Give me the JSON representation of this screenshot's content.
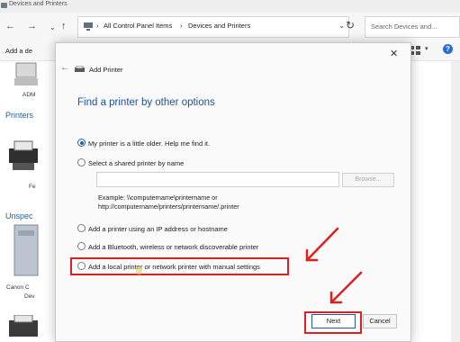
{
  "window": {
    "title": "Devices and Printers"
  },
  "addressbar": {
    "crumb1": "All Control Panel Items",
    "crumb2": "Devices and Printers",
    "sep1": "›",
    "sep2": "›",
    "nav_back": "←",
    "nav_forward": "→",
    "nav_up": "↑",
    "dropdown": "⌄",
    "refresh": "↻",
    "search_placeholder": "Search Devices and..."
  },
  "toolbar": {
    "add_label": "Add a de",
    "help": "?",
    "view_dropdown": "▾"
  },
  "sections": {
    "printers": "Printers",
    "unspecified": "Unspec"
  },
  "devices": {
    "adm": "ADM",
    "fe": "Fe",
    "canon": "Canon C",
    "dev": "Dev"
  },
  "dialog": {
    "title": "Add Printer",
    "close": "✕",
    "back": "←",
    "heading": "Find a printer by other options",
    "options": [
      {
        "label": "My printer is a little older. Help me find it.",
        "selected": true
      },
      {
        "label": "Select a shared printer by name",
        "selected": false
      },
      {
        "label": "Add a printer using an IP address or hostname",
        "selected": false
      },
      {
        "label": "Add a Bluetooth, wireless or network discoverable printer",
        "selected": false
      },
      {
        "label": "Add a local printer or network printer with manual settings",
        "selected": false
      }
    ],
    "share_value": "",
    "browse_label": "Browse...",
    "example_line1": "Example: \\\\computername\\printername or",
    "example_line2": "http://computername/printers/printername/.printer",
    "next_label": "Next",
    "cancel_label": "Cancel"
  },
  "colors": {
    "accent": "#1e5fa8",
    "annotation": "#e02020"
  }
}
